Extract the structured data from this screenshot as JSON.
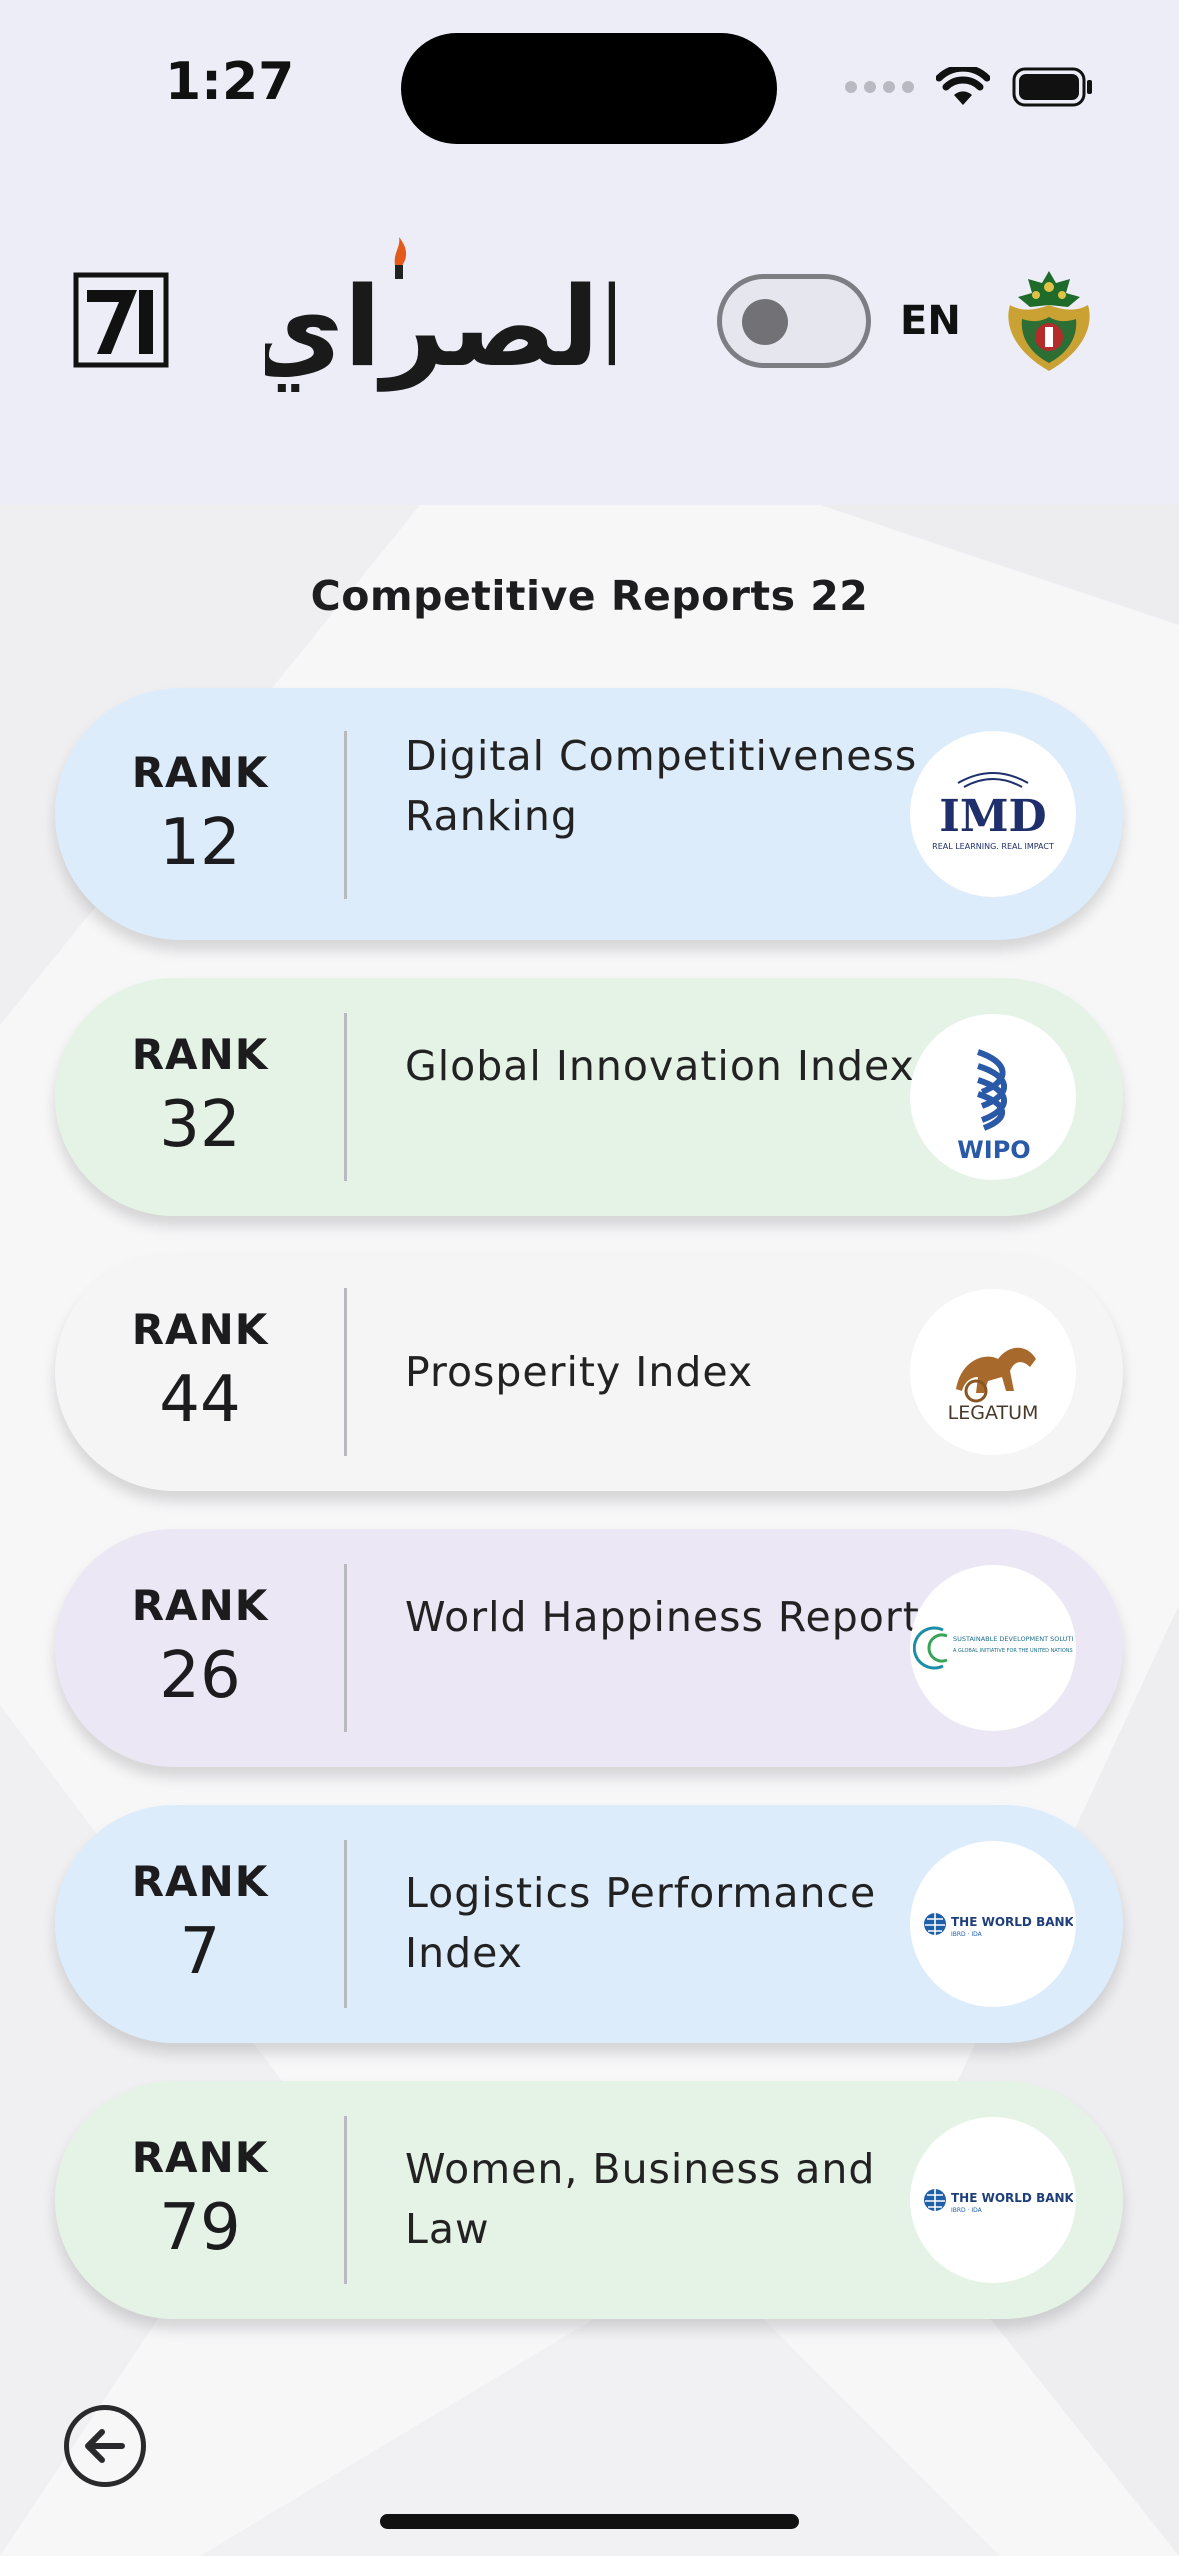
{
  "status": {
    "time": "1:27"
  },
  "header": {
    "logo_left_text": "71",
    "brand_text": "الصراي",
    "language_label": "EN",
    "toggle_on": false
  },
  "page": {
    "title": "Competitive Reports 22"
  },
  "reports": [
    {
      "rank_label": "RANK",
      "rank": "12",
      "title": "Digital Competitiveness Ranking",
      "logo": "IMD",
      "logo_sub": "REAL LEARNING. REAL IMPACT",
      "bg": "#ddecfb"
    },
    {
      "rank_label": "RANK",
      "rank": "32",
      "title": "Global Innovation Index",
      "logo": "WIPO",
      "bg": "#e5f3e6"
    },
    {
      "rank_label": "RANK",
      "rank": "44",
      "title": "Prosperity Index",
      "logo": "LEGATUM",
      "bg": "#f5f5f6"
    },
    {
      "rank_label": "RANK",
      "rank": "26",
      "title": "World Happiness Report",
      "logo": "SUSTAINABLE DEVELOPMENT SOLUTIONS NETWORK",
      "logo_sub": "A GLOBAL INITIATIVE FOR THE UNITED NATIONS",
      "bg": "#ebe7f5"
    },
    {
      "rank_label": "RANK",
      "rank": "7",
      "title": "Logistics Performance Index",
      "logo": "THE WORLD BANK",
      "logo_sub": "IBRD · IDA",
      "bg": "#ddecfb"
    },
    {
      "rank_label": "RANK",
      "rank": "79",
      "title": "Women, Business and Law",
      "logo": "THE WORLD BANK",
      "logo_sub": "IBRD · IDA",
      "bg": "#e5f3e6"
    }
  ]
}
